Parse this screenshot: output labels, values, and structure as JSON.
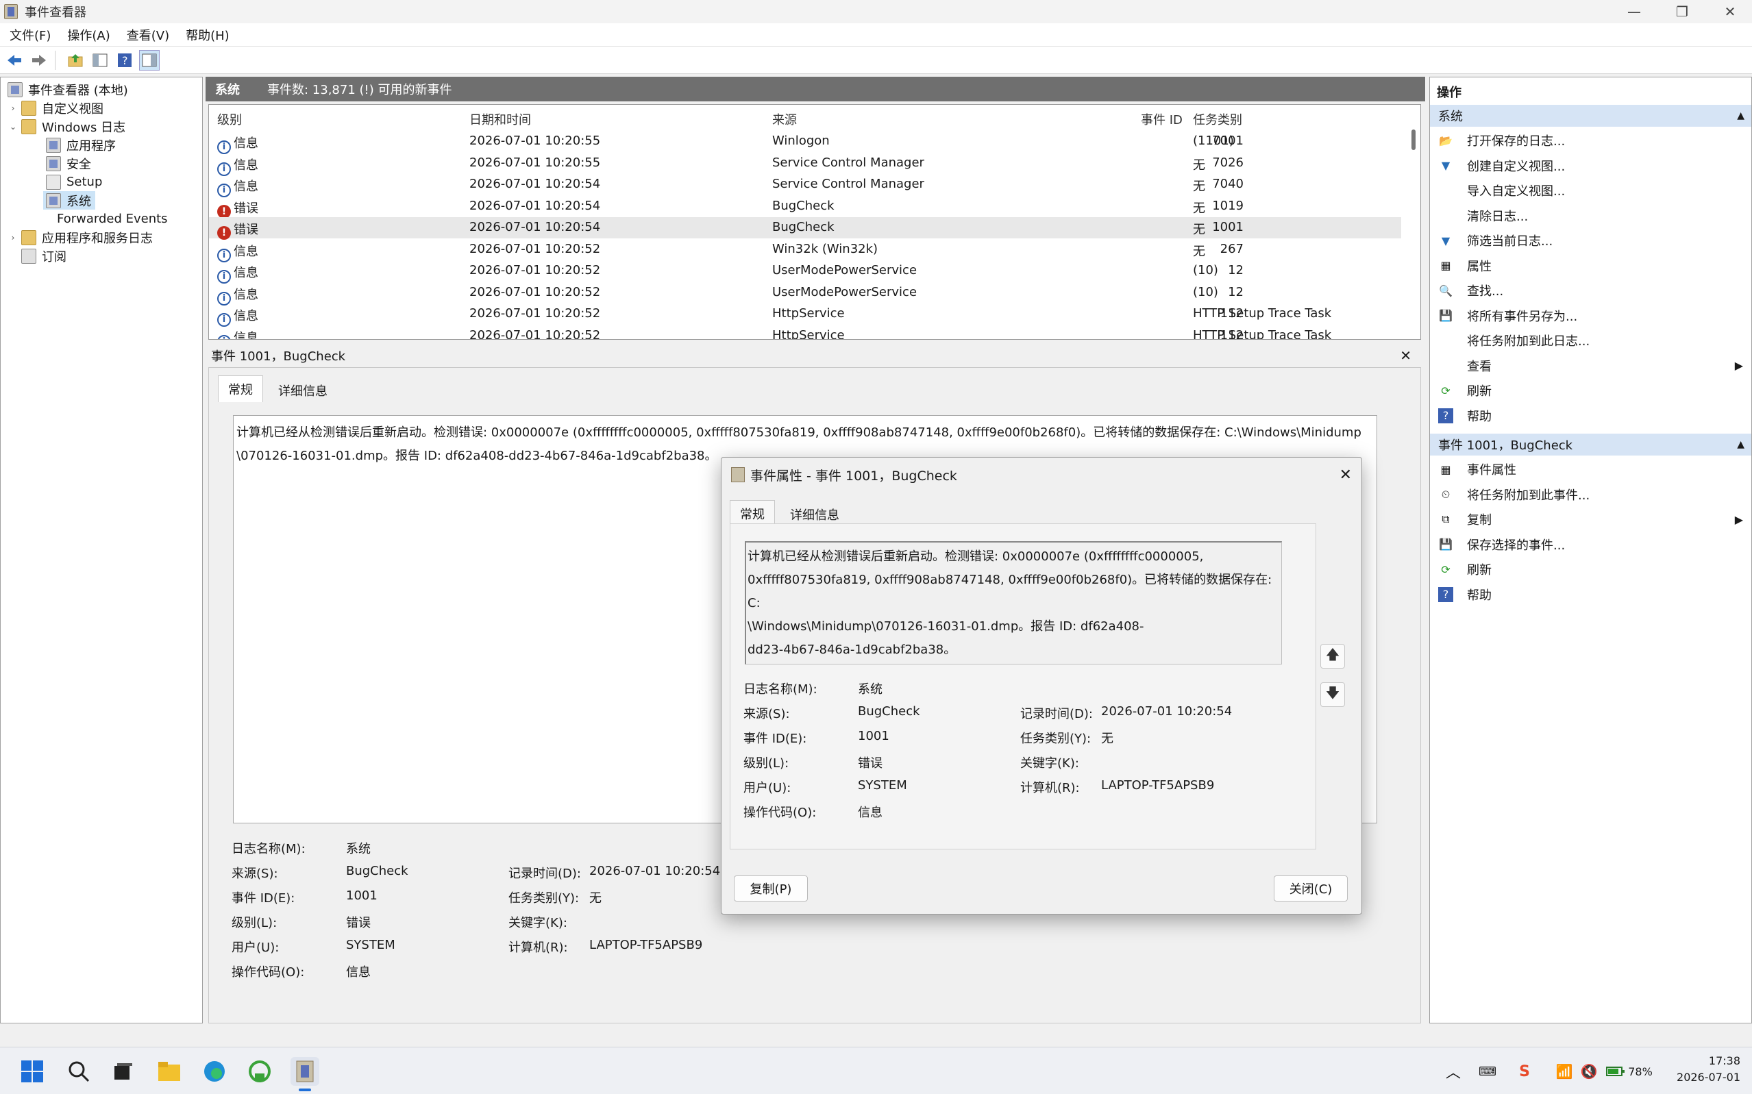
{
  "window": {
    "title": "事件查看器",
    "minimize": "—",
    "maximize": "❐",
    "close": "✕"
  },
  "menu": [
    "文件(F)",
    "操作(A)",
    "查看(V)",
    "帮助(H)"
  ],
  "tree": {
    "root": "事件查看器 (本地)",
    "custom_views": "自定义视图",
    "windows_logs": "Windows 日志",
    "logs": [
      "应用程序",
      "安全",
      "Setup",
      "系统",
      "Forwarded Events"
    ],
    "app_service_logs": "应用程序和服务日志",
    "subscriptions": "订阅"
  },
  "list_header": {
    "log_name": "系统",
    "info": "事件数: 13,871 (!) 可用的新事件"
  },
  "columns": [
    "级别",
    "日期和时间",
    "来源",
    "事件 ID",
    "任务类别"
  ],
  "events": [
    {
      "level": "信息",
      "type": "info",
      "datetime": "2026-07-01 10:20:55",
      "source": "Winlogon",
      "id": "7001",
      "task": "(1101)"
    },
    {
      "level": "信息",
      "type": "info",
      "datetime": "2026-07-01 10:20:55",
      "source": "Service Control Manager",
      "id": "7026",
      "task": "无"
    },
    {
      "level": "信息",
      "type": "info",
      "datetime": "2026-07-01 10:20:54",
      "source": "Service Control Manager",
      "id": "7040",
      "task": "无"
    },
    {
      "level": "错误",
      "type": "error",
      "datetime": "2026-07-01 10:20:54",
      "source": "BugCheck",
      "id": "1019",
      "task": "无"
    },
    {
      "level": "错误",
      "type": "error",
      "datetime": "2026-07-01 10:20:54",
      "source": "BugCheck",
      "id": "1001",
      "task": "无"
    },
    {
      "level": "信息",
      "type": "info",
      "datetime": "2026-07-01 10:20:52",
      "source": "Win32k (Win32k)",
      "id": "267",
      "task": "无"
    },
    {
      "level": "信息",
      "type": "info",
      "datetime": "2026-07-01 10:20:52",
      "source": "UserModePowerService",
      "id": "12",
      "task": "(10)"
    },
    {
      "level": "信息",
      "type": "info",
      "datetime": "2026-07-01 10:20:52",
      "source": "UserModePowerService",
      "id": "12",
      "task": "(10)"
    },
    {
      "level": "信息",
      "type": "info",
      "datetime": "2026-07-01 10:20:52",
      "source": "HttpService",
      "id": "112",
      "task": "HTTP Setup Trace Task"
    },
    {
      "level": "信息",
      "type": "info",
      "datetime": "2026-07-01 10:20:52",
      "source": "HttpService",
      "id": "112",
      "task": "HTTP Setup Trace Task"
    }
  ],
  "detail": {
    "header": "事件 1001，BugCheck",
    "tab_general": "常规",
    "tab_details": "详细信息",
    "description_line1": "计算机已经从检测错误后重新启动。检测错误: 0x0000007e (0xffffffffc0000005, 0xfffff807530fa819, 0xffff908ab8747148, 0xffff9e00f0b268f0)。已将转储的数据保存在: C:\\Windows\\Minidump",
    "description_line2": "\\070126-16031-01.dmp。报告 ID: df62a408-dd23-4b67-846a-1d9cabf2ba38。",
    "labels": {
      "log_name": "日志名称(M):",
      "source": "来源(S):",
      "event_id": "事件 ID(E):",
      "level": "级别(L):",
      "user": "用户(U):",
      "opcode": "操作代码(O):",
      "logged": "记录时间(D):",
      "task": "任务类别(Y):",
      "keywords": "关键字(K):",
      "computer": "计算机(R):"
    },
    "values": {
      "log_name": "系统",
      "source": "BugCheck",
      "event_id": "1001",
      "level": "错误",
      "user": "SYSTEM",
      "opcode": "信息",
      "logged": "2026-07-01 10:20:54",
      "task": "无",
      "keywords": "",
      "computer": "LAPTOP-TF5APSB9"
    }
  },
  "actions": {
    "title": "操作",
    "section1": "系统",
    "items1": [
      "打开保存的日志...",
      "创建自定义视图...",
      "导入自定义视图...",
      "清除日志...",
      "筛选当前日志...",
      "属性",
      "查找...",
      "将所有事件另存为...",
      "将任务附加到此日志...",
      "查看",
      "刷新",
      "帮助"
    ],
    "section2": "事件 1001，BugCheck",
    "items2": [
      "事件属性",
      "将任务附加到此事件...",
      "复制",
      "保存选择的事件...",
      "刷新",
      "帮助"
    ]
  },
  "dialog": {
    "title": "事件属性 - 事件 1001，BugCheck",
    "tab_general": "常规",
    "tab_details": "详细信息",
    "desc_lines": [
      "计算机已经从检测错误后重新启动。检测错误: 0x0000007e (0xffffffffc0000005,",
      "0xfffff807530fa819, 0xffff908ab8747148, 0xffff9e00f0b268f0)。已将转储的数据保存在: C:",
      "\\Windows\\Minidump\\070126-16031-01.dmp。报告 ID: df62a408-",
      "dd23-4b67-846a-1d9cabf2ba38。"
    ],
    "copy_button": "复制(P)",
    "close_button": "关闭(C)"
  },
  "taskbar": {
    "time": "17:38",
    "date": "2026-07-01",
    "battery": "78%"
  }
}
